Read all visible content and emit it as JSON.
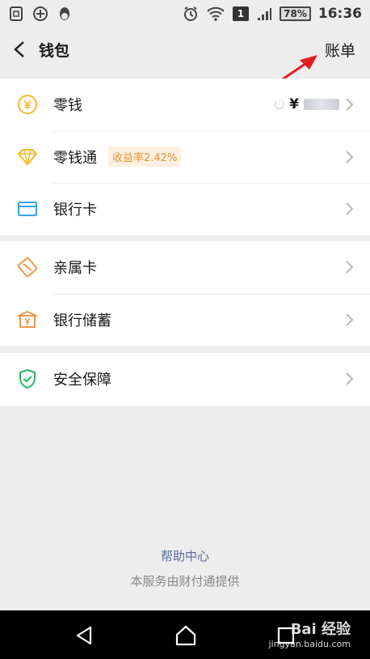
{
  "status_bar": {
    "time": "16:36",
    "battery": "78%",
    "sim_slot": "1",
    "icons": [
      "sim-card-icon",
      "plus-circle-icon",
      "qq-penguin-icon",
      "alarm-icon",
      "wifi-icon",
      "signal-icon",
      "battery-icon"
    ]
  },
  "header": {
    "title": "钱包",
    "bills_label": "账单",
    "back_icon": "chevron-left-icon"
  },
  "sections": [
    {
      "rows": [
        {
          "label": "零钱",
          "icon": "yuan-coin-icon",
          "balance_prefix": "¥"
        },
        {
          "label": "零钱通",
          "icon": "diamond-icon",
          "badge": "收益率2.42%"
        },
        {
          "label": "银行卡",
          "icon": "bank-card-icon"
        }
      ]
    },
    {
      "rows": [
        {
          "label": "亲属卡",
          "icon": "family-card-icon"
        },
        {
          "label": "银行储蓄",
          "icon": "bank-savings-icon"
        }
      ]
    },
    {
      "rows": [
        {
          "label": "安全保障",
          "icon": "shield-icon"
        }
      ]
    }
  ],
  "footer": {
    "help_link": "帮助中心",
    "provider_note": "本服务由财付通提供"
  },
  "watermark": {
    "main": "Bai 经验",
    "sub": "jingyan.baidu.com"
  },
  "colors": {
    "background": "#ededed",
    "accent_link": "#576b95",
    "badge_text": "#e0963a",
    "coin_yellow": "#f2b92b",
    "card_blue": "#2fa4e7",
    "family_orange": "#f0964a",
    "shield_green": "#2bb561",
    "annotation_red": "#e02020"
  }
}
